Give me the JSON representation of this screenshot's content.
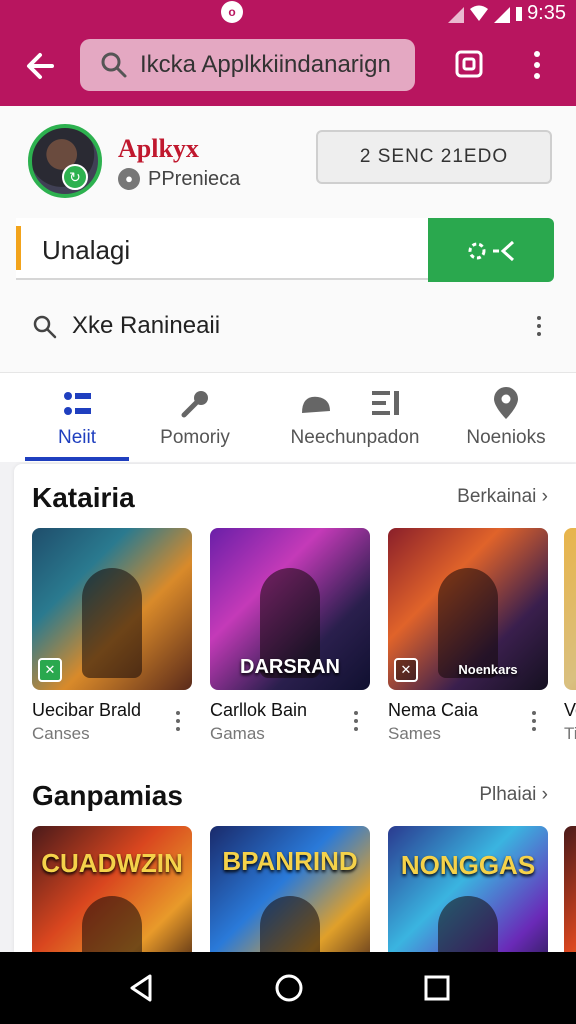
{
  "status_bar": {
    "time": "9:35",
    "notification_glyph": "o"
  },
  "app_bar": {
    "search_value": "Ikcka Applkkiindanarign",
    "icons": [
      "back-arrow-icon",
      "search-icon",
      "camera-icon",
      "more-vert-icon"
    ]
  },
  "profile": {
    "brand_name": "Aplkyx",
    "subtitle": "PPrenieca",
    "secondary_button_label": "2 SENC 21EDO"
  },
  "text_input": {
    "value": "Unalagi",
    "accent_color": "#f2a31b",
    "submit_button_glyph": "⚙ <"
  },
  "secondary_search": {
    "label": "Xke Ranineaii"
  },
  "tabs": [
    {
      "label": "Neiit",
      "icon": "grid-icon",
      "active": true
    },
    {
      "label": "Pomoriy",
      "icon": "microphone-icon",
      "active": false
    },
    {
      "label": "Neechunpadon",
      "icon": "feed-icon",
      "active": false
    },
    {
      "label": "Noenioks",
      "icon": "location-pin-icon",
      "active": false
    }
  ],
  "sections": [
    {
      "title": "Katairia",
      "more_label": "Berkainai",
      "items": [
        {
          "name": "Uecibar Brald",
          "category": "Canses",
          "thumb_text": ""
        },
        {
          "name": "Carllok Bain",
          "category": "Gamas",
          "thumb_text": "DARSRAN"
        },
        {
          "name": "Nema Caia",
          "category": "Sames",
          "thumb_text": "Noenkars"
        },
        {
          "name": "Ve",
          "category": "Ti",
          "thumb_text": ""
        }
      ]
    },
    {
      "title": "Ganpamias",
      "more_label": "Plhaiai",
      "items": [
        {
          "name": "",
          "category": "",
          "thumb_text": "CUADWZIN"
        },
        {
          "name": "",
          "category": "",
          "thumb_text": "BPANRIND"
        },
        {
          "name": "",
          "category": "",
          "thumb_text": "NONGGAS"
        },
        {
          "name": "",
          "category": "",
          "thumb_text": ""
        }
      ]
    }
  ],
  "colors": {
    "brand": "#b8155f",
    "accent_green": "#2aa84e",
    "tab_active": "#1f3fbf"
  }
}
